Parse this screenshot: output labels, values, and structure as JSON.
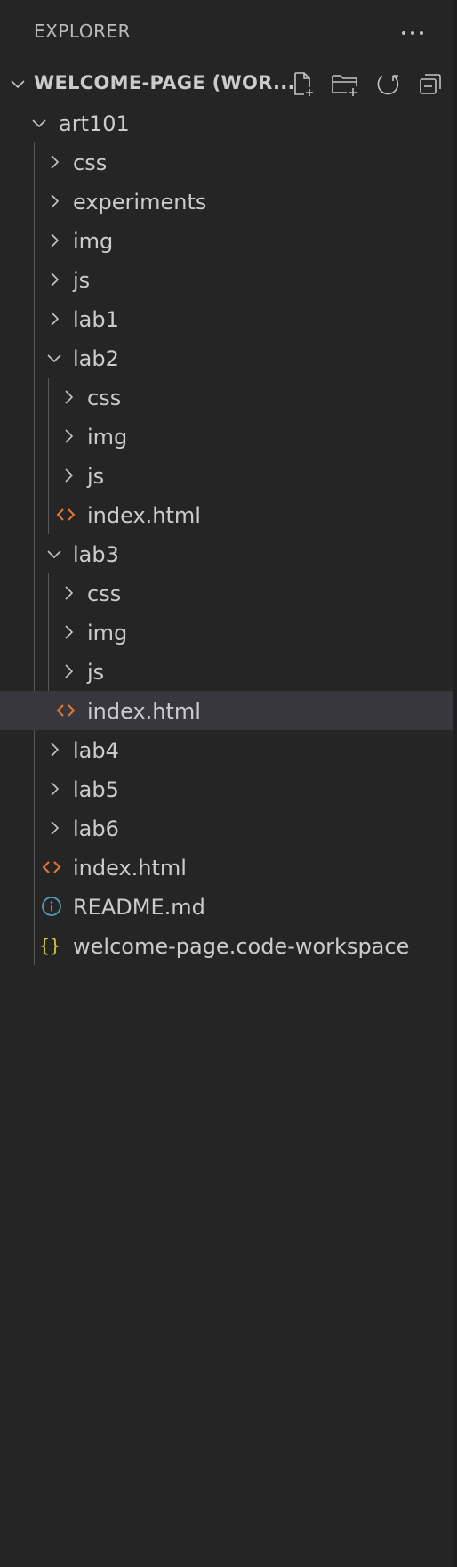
{
  "header": {
    "title": "EXPLORER",
    "more_icon": "ellipsis-icon"
  },
  "workspace": {
    "root_label": "WELCOME-PAGE (WOR...",
    "actions": [
      {
        "name": "new-file-button",
        "icon": "new-file-icon"
      },
      {
        "name": "new-folder-button",
        "icon": "new-folder-icon"
      },
      {
        "name": "refresh-button",
        "icon": "refresh-icon"
      },
      {
        "name": "collapse-all-button",
        "icon": "collapse-all-icon"
      }
    ]
  },
  "tree": {
    "art101": "art101",
    "css": "css",
    "experiments": "experiments",
    "img": "img",
    "js": "js",
    "lab1": "lab1",
    "lab2": "lab2",
    "lab2_css": "css",
    "lab2_img": "img",
    "lab2_js": "js",
    "lab2_index": "index.html",
    "lab3": "lab3",
    "lab3_css": "css",
    "lab3_img": "img",
    "lab3_js": "js",
    "lab3_index": "index.html",
    "lab4": "lab4",
    "lab5": "lab5",
    "lab6": "lab6",
    "index": "index.html",
    "readme": "README.md",
    "workspace_file": "welcome-page.code-workspace"
  },
  "icons": {
    "html": "<>",
    "json": "{}"
  },
  "colors": {
    "background": "#252526",
    "selected_row": "#37373d",
    "html_icon": "#e37933",
    "info_icon": "#519aba",
    "json_icon": "#cbcb41"
  }
}
